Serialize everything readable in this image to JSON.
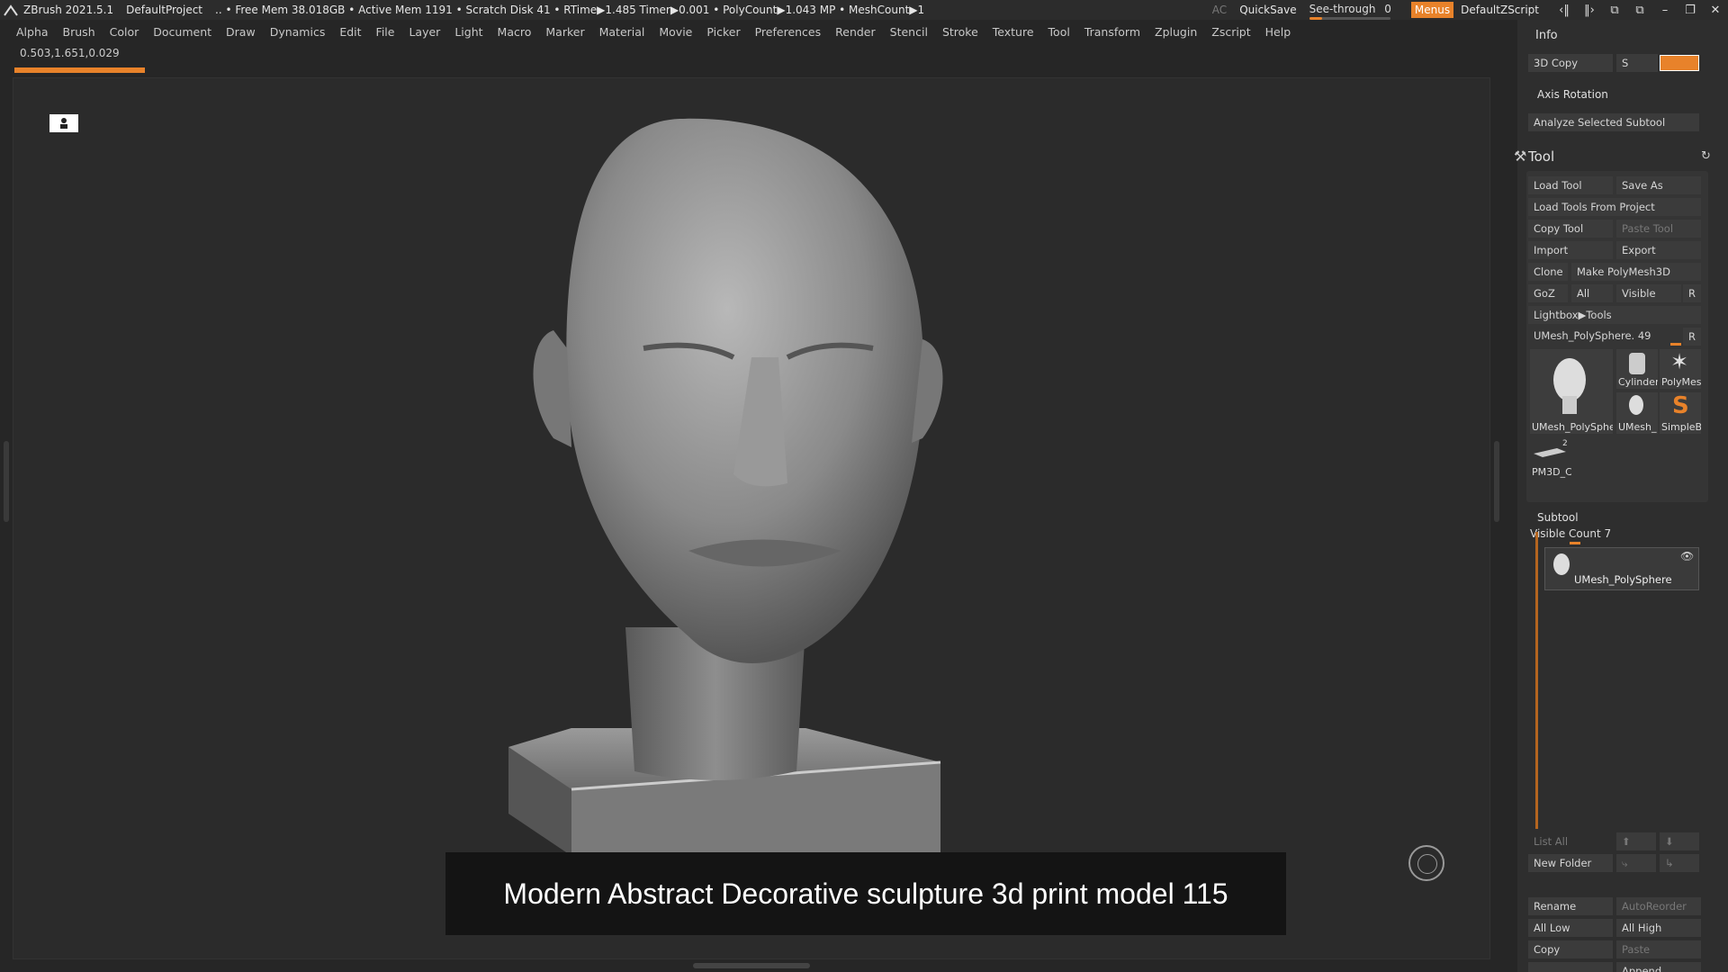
{
  "titlebar": {
    "app": "ZBrush 2021.5.1",
    "project": "DefaultProject",
    "status": ".. • Free Mem 38.018GB • Active Mem 1191 • Scratch Disk 41 •  RTime▶1.485 Timer▶0.001 • PolyCount▶1.043 MP  • MeshCount▶1",
    "ac": "AC",
    "quicksave": "QuickSave",
    "see_through_label": "See-through",
    "see_through_value": "0",
    "see_through_fraction": 0.0,
    "menus": "Menus",
    "script": "DefaultZScript"
  },
  "menubar": [
    "Alpha",
    "Brush",
    "Color",
    "Document",
    "Draw",
    "Dynamics",
    "Edit",
    "File",
    "Layer",
    "Light",
    "Macro",
    "Marker",
    "Material",
    "Movie",
    "Picker",
    "Preferences",
    "Render",
    "Stencil",
    "Stroke",
    "Texture",
    "Tool",
    "Transform",
    "Zplugin",
    "Zscript",
    "Help"
  ],
  "coords": "0.503,1.651,0.029",
  "caption": "Modern Abstract Decorative sculpture 3d print model 115",
  "panel": {
    "info_title": "Info",
    "copy3d": "3D Copy",
    "s_label": "S",
    "axis_rotation": "Axis Rotation",
    "analyze": "Analyze Selected Subtool",
    "tool_title": "Tool",
    "load_tool": "Load Tool",
    "save_as": "Save As",
    "load_from_project": "Load Tools From Project",
    "copy_tool": "Copy Tool",
    "paste_tool": "Paste Tool",
    "import": "Import",
    "export": "Export",
    "clone": "Clone",
    "make_polymesh": "Make PolyMesh3D",
    "goz": "GoZ",
    "all": "All",
    "visible": "Visible",
    "r": "R",
    "lightbox_tools": "Lightbox▶Tools",
    "current_tool": "UMesh_PolySphere. 49",
    "thumbs": {
      "main": "UMesh_PolySphe",
      "cylinder": "Cylinder",
      "polymesh": "PolyMes",
      "umesh_small": "UMesh_",
      "simpleb": "SimpleB",
      "pm3d": "PM3D_C",
      "pm3d_count": "2"
    },
    "subtool_title": "Subtool",
    "visible_count": "Visible Count 7",
    "subtool_item": "UMesh_PolySphere",
    "list_all": "List All",
    "new_folder": "New Folder",
    "rename": "Rename",
    "autoreorder": "AutoReorder",
    "all_low": "All Low",
    "all_high": "All High",
    "copy": "Copy",
    "paste": "Paste",
    "append": "Append"
  },
  "colors": {
    "accent": "#e8822a",
    "panel_bg": "#2e2e2e",
    "canvas_bg": "#2b2b2b"
  }
}
